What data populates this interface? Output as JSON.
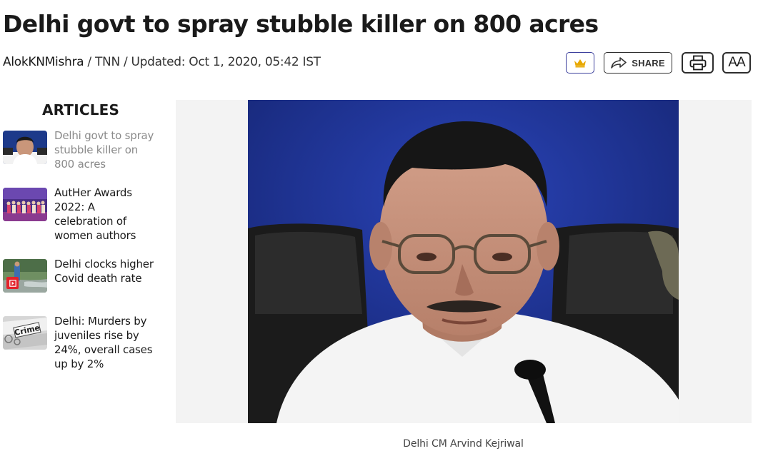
{
  "article": {
    "headline": "Delhi govt to spray stubble killer on 800 acres",
    "byline": {
      "author": "AlokKNMishra",
      "source": "TNN",
      "updated": "Updated: Oct 1, 2020, 05:42 IST"
    }
  },
  "toolbar": {
    "crown_icon": "crown-icon",
    "share_label": "SHARE",
    "share_icon": "share-arrow-icon",
    "print_icon": "printer-icon",
    "font_label": "AA"
  },
  "sidebar": {
    "heading": "ARTICLES",
    "items": [
      {
        "title": "Delhi govt to spray stubble killer on 800 acres",
        "active": true
      },
      {
        "title": "AutHer Awards 2022: A celebration of women authors",
        "active": false
      },
      {
        "title": "Delhi clocks higher Covid death rate",
        "active": false,
        "video": true
      },
      {
        "title": "Delhi: Murders by juveniles rise by 24%, overall cases up by 2%",
        "active": false
      },
      {
        "thumb_text": "Crime"
      }
    ]
  },
  "hero": {
    "caption": "Delhi CM Arvind Kejriwal"
  },
  "colors": {
    "crown": "#e8a800",
    "video_badge": "#e3222b",
    "hero_backdrop": "#1b2f8f"
  }
}
